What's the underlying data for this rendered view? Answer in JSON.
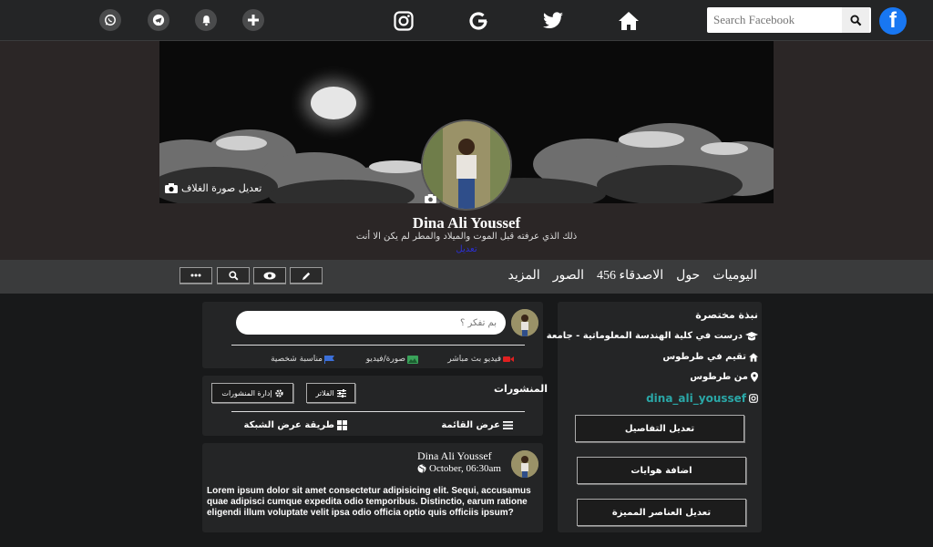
{
  "topbar": {
    "search_placeholder": "Search Facebook",
    "brand_logo": "f",
    "icons": [
      "whatsapp-icon",
      "telegram-icon",
      "bell-icon",
      "plus-icon",
      "instagram-icon",
      "google-icon",
      "twitter-icon",
      "home-icon",
      "search-icon",
      "facebook-logo"
    ]
  },
  "profile": {
    "cover_edit_label": "تعديل صورة الغلاف",
    "name": "Dina Ali Youssef",
    "bio": "ذلك الذي عرفته قبل الموت والميلاد والمطر لم يكن الا أنت",
    "bio_edit_label": "تعديل"
  },
  "nav": {
    "items": [
      "اليوميات",
      "حول",
      "الاصدقاء 456",
      "الصور",
      "المزيد"
    ]
  },
  "about": {
    "title": "نبذة مختصرة",
    "education": "درست في كلية الهندسة المعلوماتية - جامعة تشرين",
    "lives_in": "تقيم في طرطوس",
    "from": "من طرطوس",
    "instagram": "dina_ali_youssef",
    "buttons": [
      "تعديل التفاصيل",
      "اضافة هوايات",
      "تعديل العناصر المميزة"
    ]
  },
  "composer": {
    "placeholder": "بم تفكر ؟",
    "options": [
      "فيديو بث مباشر",
      "صورة/فيديو",
      "مناسبة شخصية"
    ]
  },
  "posts_section": {
    "title": "المنشورات",
    "filter_label": "الفلاتر",
    "manage_label": "إدارة المنشورات",
    "list_view": "عرض القائمة",
    "grid_view": "طريقة عرض الشبكة"
  },
  "post": {
    "author": "Dina Ali Youssef",
    "time": "October, 06:30am",
    "body": "Lorem ipsum dolor sit amet consectetur adipisicing elit. Sequi, accusamus quae adipisci cumque expedita odio temporibus. Distinctio, earum ratione eligendi illum voluptate velit ipsa odio officia optio quis officiis ipsum?"
  },
  "colors": {
    "background": "#18191a",
    "panel": "#242526",
    "nav": "#3a3b3c",
    "facebook_blue": "#1877f2",
    "instagram_link": "#2aa7a7",
    "live_video_red": "#e02020",
    "photo_green": "#3aa35a",
    "event_blue": "#3b6fd8"
  }
}
